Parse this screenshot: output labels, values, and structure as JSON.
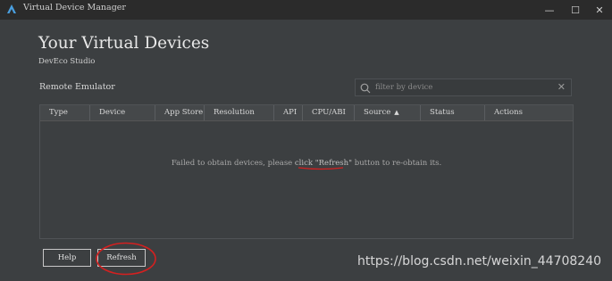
{
  "window": {
    "title": "Virtual Device Manager",
    "minimize_glyph": "—",
    "maximize_glyph": "☐",
    "close_glyph": "✕"
  },
  "page": {
    "heading": "Your Virtual Devices",
    "subheading": "DevEco Studio",
    "section_label": "Remote Emulator"
  },
  "search": {
    "placeholder": "filter by device",
    "clear_glyph": "✕"
  },
  "table": {
    "columns": [
      "Type",
      "Device",
      "App Store",
      "Resolution",
      "API",
      "CPU/ABI",
      "Source",
      "Status",
      "Actions"
    ],
    "sort_glyph": "▲",
    "empty_prefix": "Failed to obtain devices, please ",
    "empty_link": "click \"Refresh\"",
    "empty_suffix": " button to re-obtain its."
  },
  "buttons": {
    "help": "Help",
    "refresh": "Refresh"
  },
  "watermark": "https://blog.csdn.net/weixin_44708240",
  "colors": {
    "background": "#3c3f41",
    "titlebar": "#2b2b2b",
    "annotation_red": "#d42020"
  }
}
